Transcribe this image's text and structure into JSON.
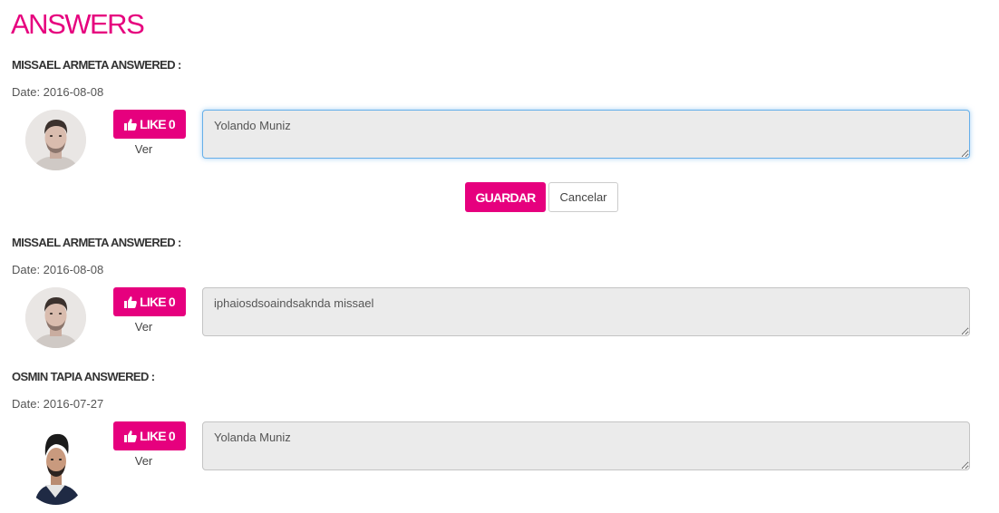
{
  "page": {
    "title": "ANSWERS"
  },
  "answers": [
    {
      "author_line": "MISSAEL ARMETA ANSWERED :",
      "date": "Date: 2016-08-08",
      "like_label": "LIKE 0",
      "ver_label": "Ver",
      "text": "Yolando Muniz",
      "editing": true,
      "avatar": "avatar-man-light",
      "save_label": "GUARDAR",
      "cancel_label": "Cancelar"
    },
    {
      "author_line": "MISSAEL ARMETA ANSWERED :",
      "date": "Date: 2016-08-08",
      "like_label": "LIKE 0",
      "ver_label": "Ver",
      "text": "iphaiosdsoaindsaknda missael",
      "editing": false,
      "avatar": "avatar-man-light"
    },
    {
      "author_line": "OSMIN TAPIA ANSWERED :",
      "date": "Date: 2016-07-27",
      "like_label": "LIKE 0",
      "ver_label": "Ver",
      "text": "Yolanda Muniz",
      "editing": false,
      "avatar": "avatar-man-dark"
    }
  ],
  "colors": {
    "accent": "#e6007e",
    "textarea_bg": "#ebebeb",
    "focus_border": "#66afe9"
  }
}
